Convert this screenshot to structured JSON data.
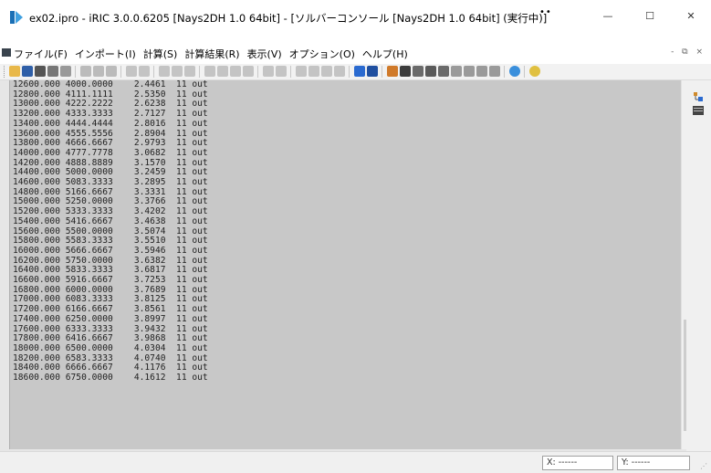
{
  "window": {
    "title": "ex02.ipro - iRIC 3.0.0.6205 [Nays2DH 1.0 64bit] - [ソルバーコンソール [Nays2DH 1.0 64bit] (実行中)]",
    "extra_dots": "••",
    "minimize_glyph": "—",
    "maximize_glyph": "☐",
    "close_glyph": "✕"
  },
  "menu": {
    "items": [
      {
        "label": "ファイル(F)"
      },
      {
        "label": "インポート(I)"
      },
      {
        "label": "計算(S)"
      },
      {
        "label": "計算結果(R)"
      },
      {
        "label": "表示(V)"
      },
      {
        "label": "オプション(O)"
      },
      {
        "label": "ヘルプ(H)"
      }
    ],
    "mdi_controls": "- ⧉ ×"
  },
  "console": {
    "lines": [
      "12600.000 4000.0000    2.4461  11 out",
      "12800.000 4111.1111    2.5350  11 out",
      "13000.000 4222.2222    2.6238  11 out",
      "13200.000 4333.3333    2.7127  11 out",
      "13400.000 4444.4444    2.8016  11 out",
      "13600.000 4555.5556    2.8904  11 out",
      "13800.000 4666.6667    2.9793  11 out",
      "14000.000 4777.7778    3.0682  11 out",
      "14200.000 4888.8889    3.1570  11 out",
      "14400.000 5000.0000    3.2459  11 out",
      "14600.000 5083.3333    3.2895  11 out",
      "14800.000 5166.6667    3.3331  11 out",
      "15000.000 5250.0000    3.3766  11 out",
      "15200.000 5333.3333    3.4202  11 out",
      "15400.000 5416.6667    3.4638  11 out",
      "15600.000 5500.0000    3.5074  11 out",
      "15800.000 5583.3333    3.5510  11 out",
      "16000.000 5666.6667    3.5946  11 out",
      "16200.000 5750.0000    3.6382  11 out",
      "16400.000 5833.3333    3.6817  11 out",
      "16600.000 5916.6667    3.7253  11 out",
      "16800.000 6000.0000    3.7689  11 out",
      "17000.000 6083.3333    3.8125  11 out",
      "17200.000 6166.6667    3.8561  11 out",
      "17400.000 6250.0000    3.8997  11 out",
      "17600.000 6333.3333    3.9432  11 out",
      "17800.000 6416.6667    3.9868  11 out",
      "18000.000 6500.0000    4.0304  11 out",
      "18200.000 6583.3333    4.0740  11 out",
      "18400.000 6666.6667    4.1176  11 out",
      "18600.000 6750.0000    4.1612  11 out"
    ]
  },
  "scrollbar": {
    "up_glyph": "^",
    "down_glyph": "v"
  },
  "status": {
    "x": "X: ------",
    "y": "Y: ------"
  },
  "colors": {
    "console_bg": "#c8c8c8",
    "app_icon": "#1a6fb5"
  }
}
